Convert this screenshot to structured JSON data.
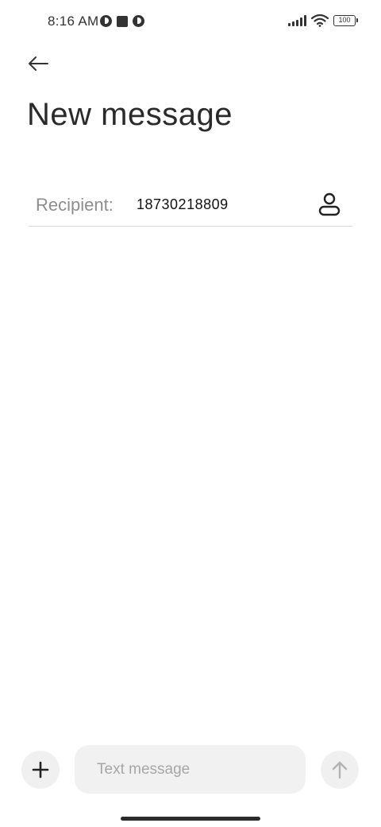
{
  "status_bar": {
    "time": "8:16 AM",
    "battery": "100",
    "icons": [
      "notification-circle-icon",
      "notification-square-icon",
      "notification-circle-icon",
      "signal-icon",
      "wifi-icon",
      "battery-icon"
    ]
  },
  "header": {
    "back_icon": "arrow-left-icon",
    "title": "New message"
  },
  "recipient": {
    "label": "Recipient:",
    "value": "18730218809",
    "contact_icon": "contact-person-icon"
  },
  "composer": {
    "add_icon": "plus-icon",
    "placeholder": "Text message",
    "value": "",
    "send_icon": "arrow-up-icon"
  },
  "colors": {
    "background": "#ffffff",
    "title_text": "#2a2a2a",
    "muted_text": "#8d8d8d",
    "input_background": "#f1f1f1",
    "divider": "#d9d9d9"
  }
}
